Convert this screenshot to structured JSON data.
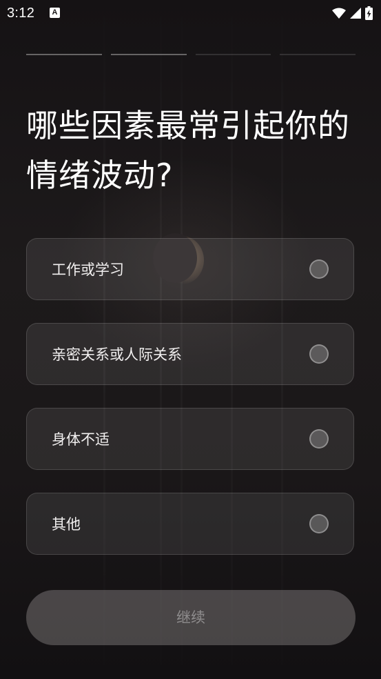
{
  "status_bar": {
    "time": "3:12",
    "notification_icon": "A",
    "icons": [
      "wifi-icon",
      "cellular-signal-icon",
      "battery-charging-icon"
    ]
  },
  "progress": {
    "total_steps": 4,
    "current_step": 2
  },
  "question": {
    "title": "哪些因素最常引起你的情绪波动?"
  },
  "options": [
    {
      "label": "工作或学习",
      "selected": false
    },
    {
      "label": "亲密关系或人际关系",
      "selected": false
    },
    {
      "label": "身体不适",
      "selected": false
    },
    {
      "label": "其他",
      "selected": false
    }
  ],
  "continue_button": {
    "label": "继续",
    "enabled": false
  },
  "colors": {
    "background": "#1a1718",
    "text": "#ffffff",
    "card_bg": "rgba(255,255,255,0.085)",
    "button_disabled": "#5f5b5c"
  }
}
